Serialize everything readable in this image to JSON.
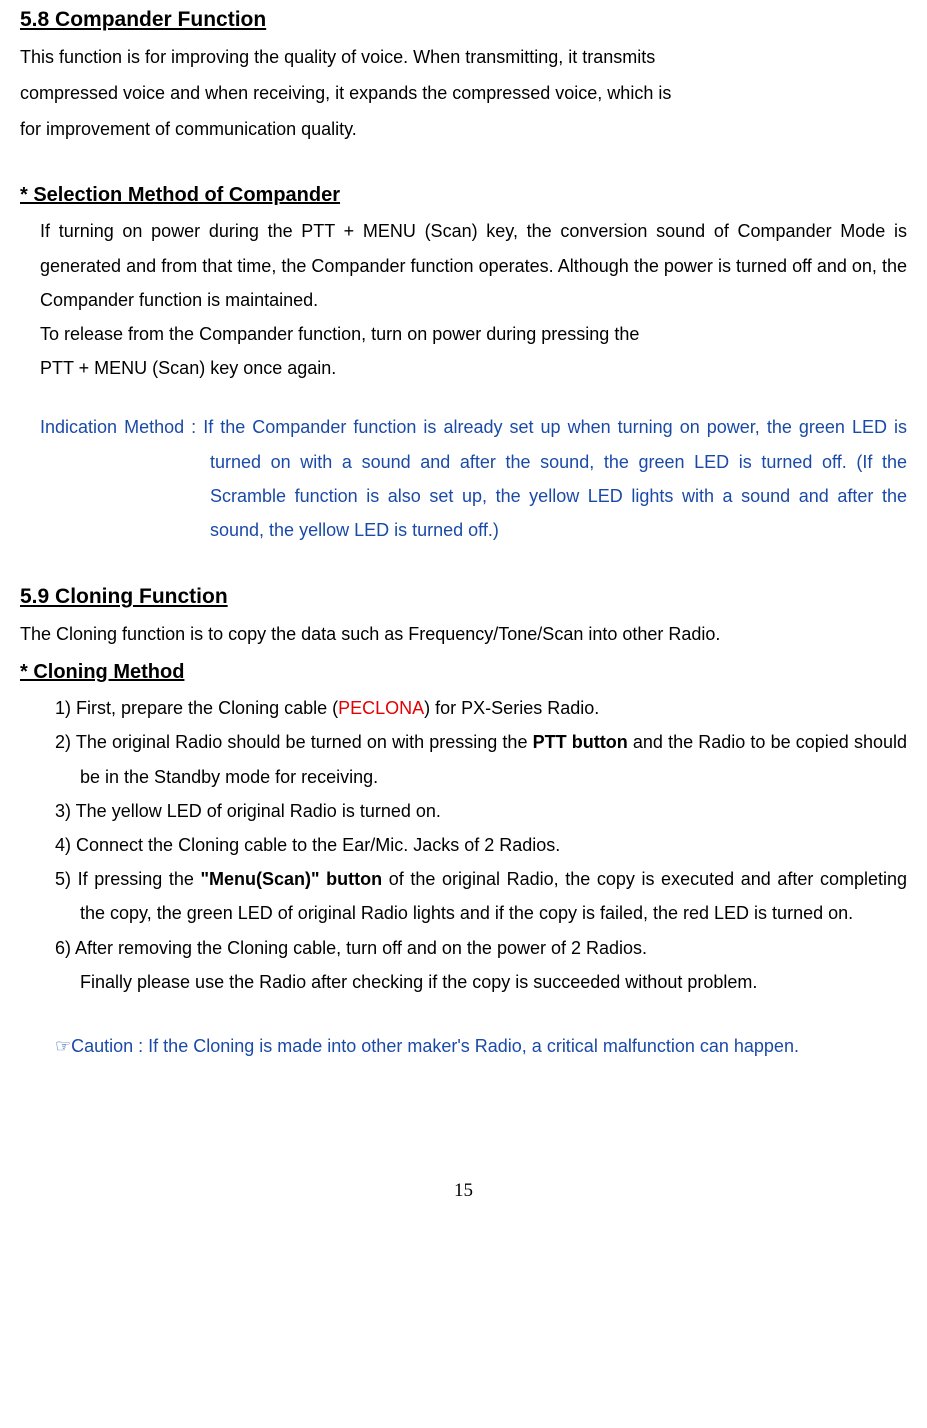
{
  "section58": {
    "heading": "5.8 Compander Function",
    "para1": "This function is for improving the quality of voice. When transmitting, it transmits",
    "para2": "compressed voice and when receiving, it expands the compressed voice, which is",
    "para3": "for improvement of communication quality.",
    "subheading": "* Selection Method of Compander",
    "indent1": "If turning on power during the PTT + MENU (Scan) key, the conversion sound of Compander Mode is generated and from that time, the Compander function operates. Although the power is turned off and on, the Compander function is maintained.",
    "indent2": "To release from the Compander function, turn on power during pressing the",
    "indent3": "PTT + MENU (Scan) key once again.",
    "indication_label": "Indication Method : ",
    "indication_rest": "If the Compander function is already set up when turning on power, the green LED is turned on with a sound and after the sound, the green LED is turned off. (If the Scramble function is also set up, the yellow LED lights with a sound and after the sound, the yellow LED is turned off.)"
  },
  "section59": {
    "heading": "5.9 Cloning Function",
    "intro": "The Cloning function is to copy the data such as Frequency/Tone/Scan into other Radio.",
    "subheading": "* Cloning Method",
    "item1_pre": "1) First, prepare the Cloning cable (",
    "item1_red": "PECLONA",
    "item1_post": ") for PX-Series Radio.",
    "item2_pre": "2) The original Radio should be turned on with pressing the ",
    "item2_bold": "PTT button",
    "item2_post": " and the Radio to be copied should be in the Standby mode for receiving.",
    "item3": "3) The yellow LED of original Radio is turned on.",
    "item4": "4) Connect the Cloning cable to the Ear/Mic. Jacks of 2 Radios.",
    "item5_pre": "5) If pressing the ",
    "item5_bold": "\"Menu(Scan)\" button",
    "item5_post": " of the original Radio, the copy is executed and after completing the copy, the green LED of original Radio lights and if the copy is failed, the red LED is turned on.",
    "item6": "6) After removing the Cloning cable, turn off and on the power of 2 Radios.",
    "item6sub": "Finally please use the Radio after checking if the copy is succeeded without problem.",
    "caution": "☞Caution : If the Cloning is made into other maker's Radio, a critical malfunction can happen."
  },
  "page_num": "15"
}
